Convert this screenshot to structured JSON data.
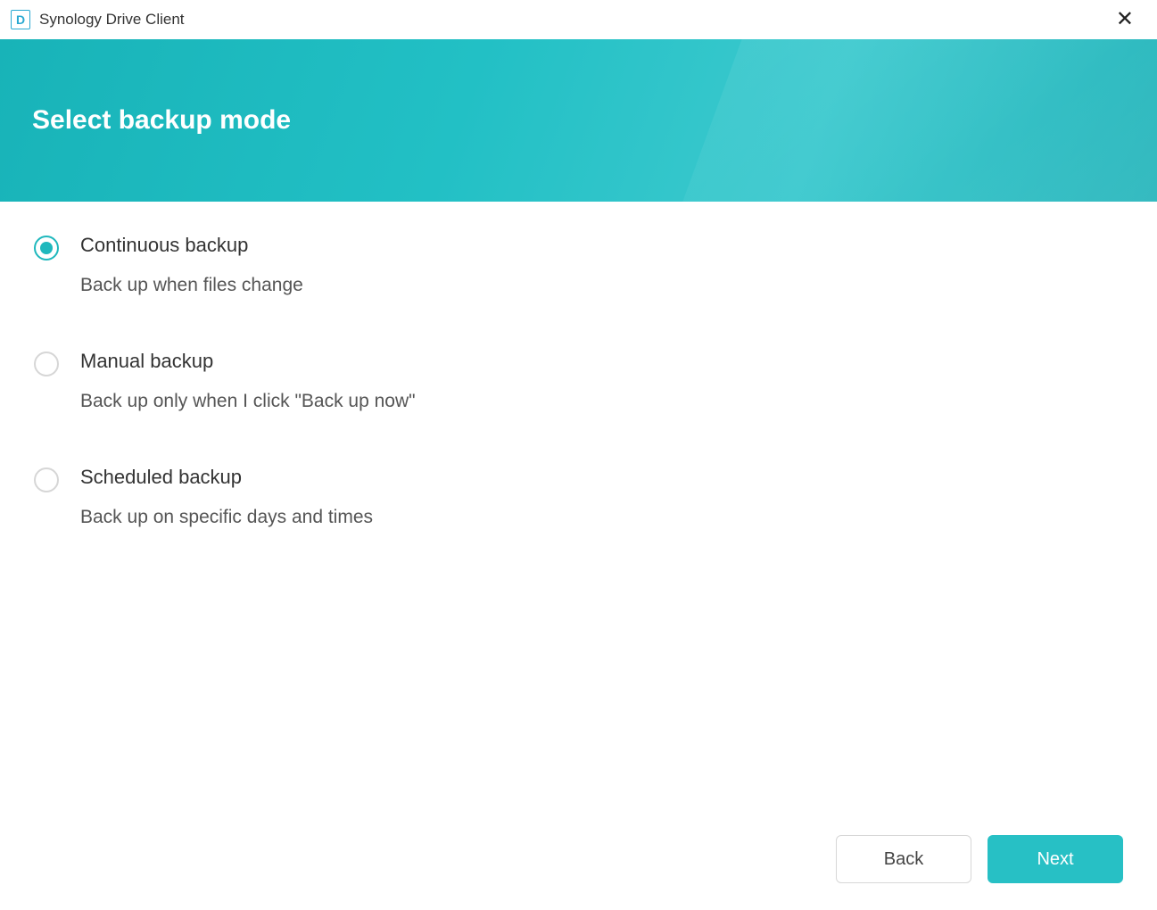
{
  "titlebar": {
    "app_icon_letter": "D",
    "app_title": "Synology Drive Client"
  },
  "header": {
    "title": "Select backup mode"
  },
  "options": [
    {
      "id": "continuous",
      "label": "Continuous backup",
      "description": "Back up when files change",
      "selected": true
    },
    {
      "id": "manual",
      "label": "Manual backup",
      "description": "Back up only when I click \"Back up now\"",
      "selected": false
    },
    {
      "id": "scheduled",
      "label": "Scheduled backup",
      "description": "Back up on specific days and times",
      "selected": false
    }
  ],
  "footer": {
    "back_label": "Back",
    "next_label": "Next"
  },
  "colors": {
    "accent": "#1fb8bd",
    "header_bg": "#22c0c5",
    "next_btn": "#27c0c5"
  }
}
